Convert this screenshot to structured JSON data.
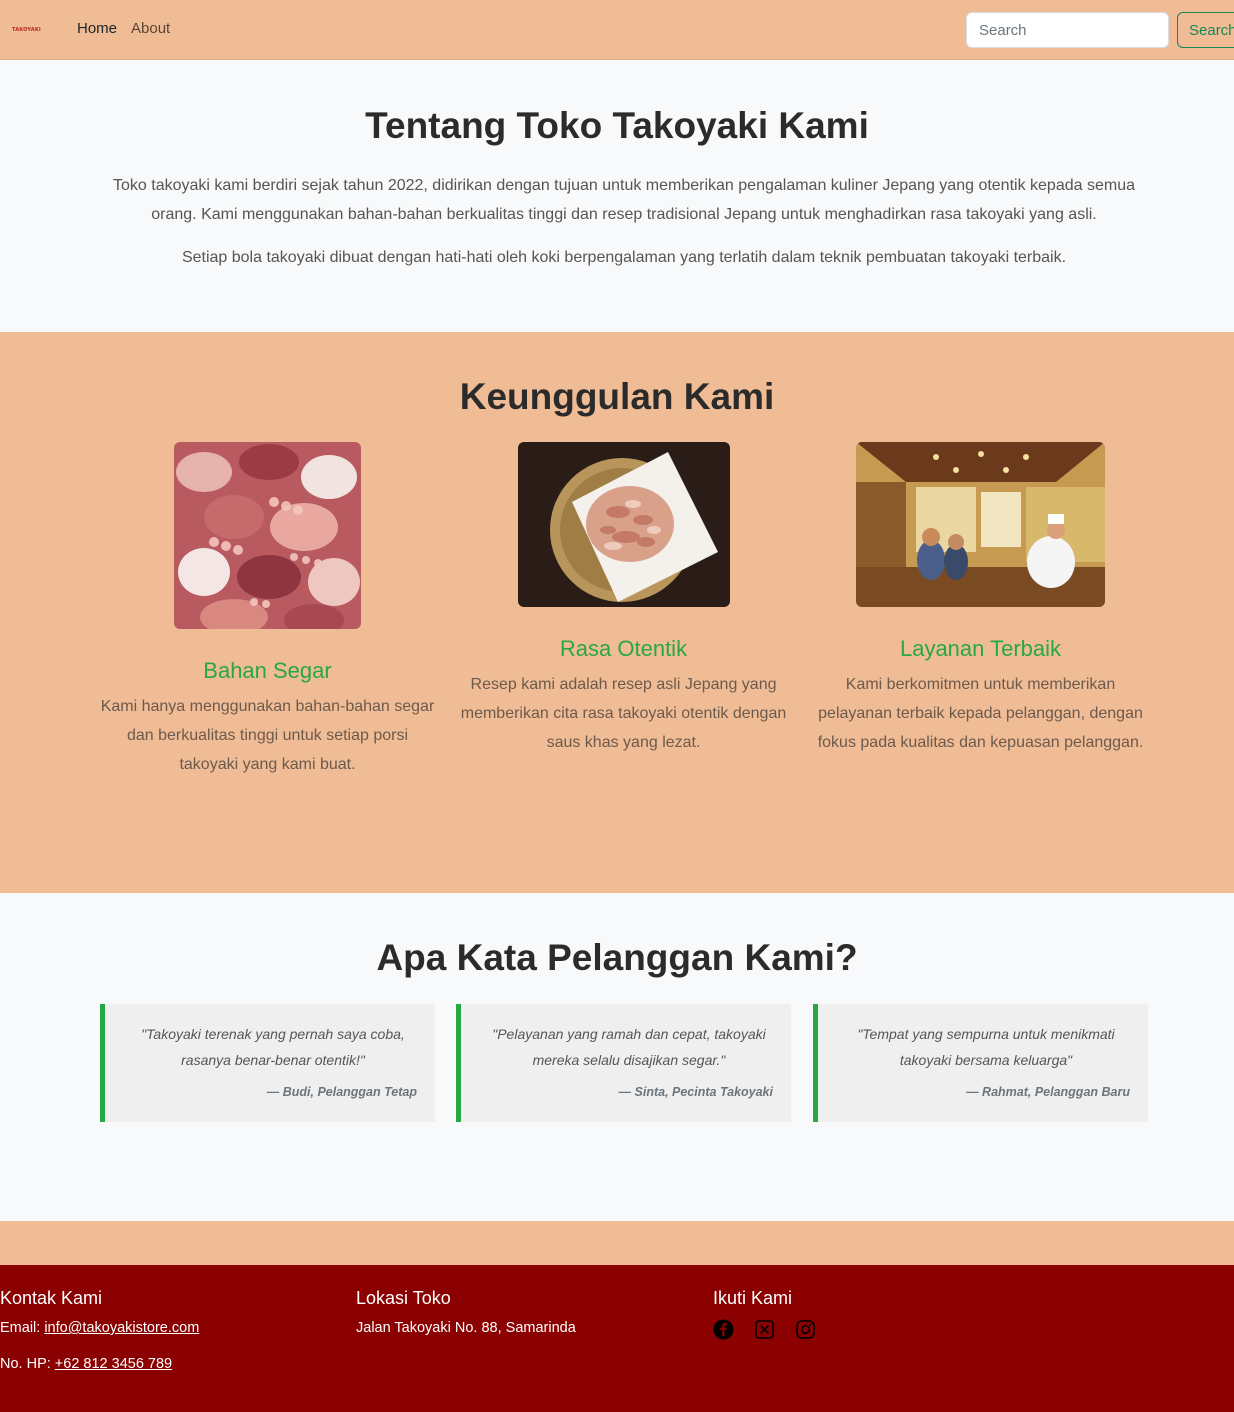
{
  "navbar": {
    "logo_text": "TAKOYAKI",
    "links": [
      "Home",
      "About"
    ],
    "search_placeholder": "Search",
    "search_button": "Search"
  },
  "about": {
    "title": "Tentang Toko Takoyaki Kami",
    "paragraph1": "Toko takoyaki kami berdiri sejak tahun 2022, didirikan dengan tujuan untuk memberikan pengalaman kuliner Jepang yang otentik kepada semua orang. Kami menggunakan bahan-bahan berkualitas tinggi dan resep tradisional Jepang untuk menghadirkan rasa takoyaki yang asli.",
    "paragraph2": "Setiap bola takoyaki dibuat dengan hati-hati oleh koki berpengalaman yang terlatih dalam teknik pembuatan takoyaki terbaik."
  },
  "features": {
    "title": "Keunggulan Kami",
    "items": [
      {
        "title": "Bahan Segar",
        "text": "Kami hanya menggunakan bahan-bahan segar dan berkualitas tinggi untuk setiap porsi takoyaki yang kami buat."
      },
      {
        "title": "Rasa Otentik",
        "text": "Resep kami adalah resep asli Jepang yang memberikan cita rasa takoyaki otentik dengan saus khas yang lezat."
      },
      {
        "title": "Layanan Terbaik",
        "text": "Kami berkomitmen untuk memberikan pelayanan terbaik kepada pelanggan, dengan fokus pada kualitas dan kepuasan pelanggan."
      }
    ]
  },
  "testimonials": {
    "title": "Apa Kata Pelanggan Kami?",
    "items": [
      {
        "quote": "\"Takoyaki terenak yang pernah saya coba, rasanya benar-benar otentik!\"",
        "author": "— Budi, Pelanggan Tetap"
      },
      {
        "quote": "\"Pelayanan yang ramah dan cepat, takoyaki mereka selalu disajikan segar.\"",
        "author": "— Sinta, Pecinta Takoyaki"
      },
      {
        "quote": "\"Tempat yang sempurna untuk menikmati takoyaki bersama keluarga\"",
        "author": "— Rahmat, Pelanggan Baru"
      }
    ]
  },
  "footer": {
    "contact": {
      "title": "Kontak Kami",
      "email_label": "Email: ",
      "email": "info@takoyakistore.com",
      "phone_label": "No. HP: ",
      "phone": "+62 812 3456 789"
    },
    "location": {
      "title": "Lokasi Toko",
      "address": "Jalan Takoyaki No. 88, Samarinda"
    },
    "social": {
      "title": "Ikuti Kami",
      "icons": [
        "facebook-icon",
        "x-icon",
        "instagram-icon"
      ]
    }
  },
  "colors": {
    "peach": "#f0bc96",
    "accent_green": "#28a745",
    "footer_red": "#8b0000"
  }
}
